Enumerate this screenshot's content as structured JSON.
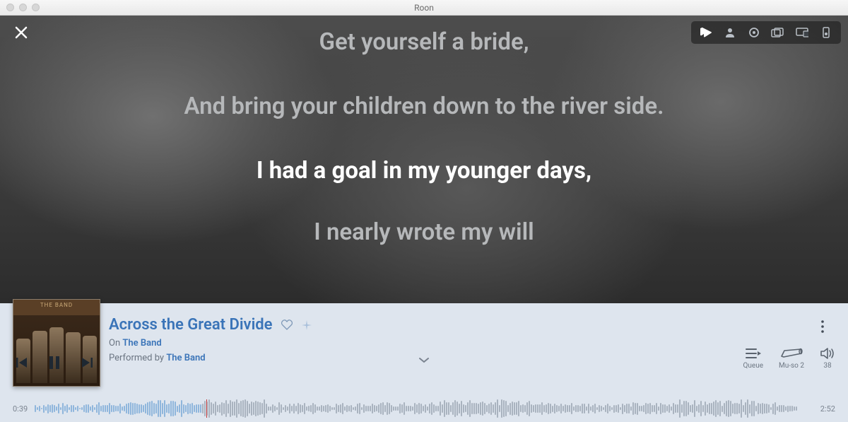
{
  "window": {
    "title": "Roon"
  },
  "lyrics": {
    "lines": [
      "Get yourself a bride,",
      "And bring your children down to the river side.",
      "I had a goal in my younger days,",
      "I nearly wrote my will"
    ],
    "current_index": 2
  },
  "toolbar": {
    "icons": [
      "lyrics-icon",
      "user-icon",
      "radio-icon",
      "albums-icon",
      "cast-icon",
      "output-icon"
    ]
  },
  "now_playing": {
    "album_cover_label": "THE BAND",
    "track_title": "Across the Great Divide",
    "on_prefix": "On ",
    "album": "The Band",
    "performed_prefix": "Performed by ",
    "artist": "The Band"
  },
  "transport": {
    "elapsed": "0:39",
    "total": "2:52",
    "progress_pct": 22
  },
  "right_controls": {
    "queue_label": "Queue",
    "zone_label": "Mu-so 2",
    "volume_value": "38"
  }
}
